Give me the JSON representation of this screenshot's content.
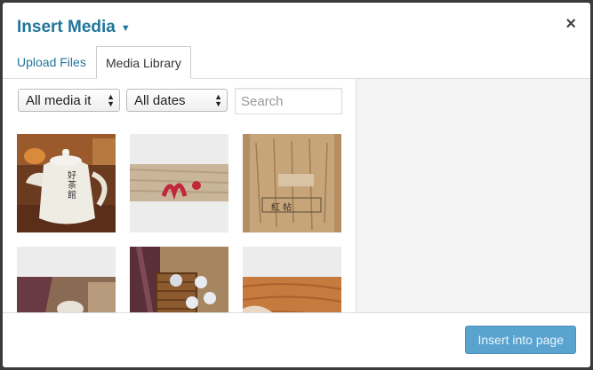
{
  "modal": {
    "title": "Insert Media",
    "close_glyph": "×"
  },
  "tabs": [
    {
      "label": "Upload Files",
      "active": false
    },
    {
      "label": "Media Library",
      "active": true
    }
  ],
  "filters": {
    "media_type": "All media it",
    "dates": "All dates"
  },
  "search": {
    "placeholder": "Search",
    "value": ""
  },
  "footer": {
    "insert_label": "Insert into page"
  },
  "colors": {
    "accent": "#21759b",
    "button": "#5aa3cf"
  },
  "icons": {
    "title_caret": "caret-down-icon",
    "close": "close-icon",
    "select_arrows": "sort-arrows-icon"
  },
  "media_items": [
    {
      "kind": "teapot-photo",
      "caption": "好茶館"
    },
    {
      "kind": "red-stamp-photo"
    },
    {
      "kind": "tea-package-photo",
      "caption": "紅 帖"
    },
    {
      "kind": "cloth-photo"
    },
    {
      "kind": "tea-tray-photo"
    },
    {
      "kind": "wood-photo"
    }
  ]
}
